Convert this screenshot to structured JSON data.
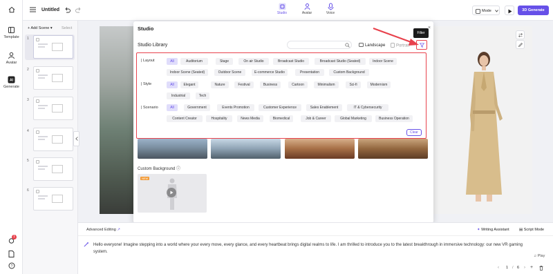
{
  "rail": {
    "items": [
      {
        "label": "Template",
        "icon": "template-icon"
      },
      {
        "label": "Avatar",
        "icon": "avatar-icon"
      },
      {
        "label": "Generate",
        "icon": "ai-generate-icon"
      }
    ],
    "notification_count": "1"
  },
  "topbar": {
    "project_title": "Untitled",
    "tabs": [
      {
        "label": "Studio",
        "icon": "studio-icon"
      },
      {
        "label": "Avatar",
        "icon": "avatar-icon"
      },
      {
        "label": "Voice",
        "icon": "voice-icon"
      }
    ],
    "mode_label": "Mode",
    "generate_label": "3D Generate"
  },
  "scenes": {
    "add_label": "Add Scene",
    "select_label": "Select",
    "items": [
      "1",
      "2",
      "3",
      "4",
      "5",
      "6"
    ]
  },
  "studio": {
    "title": "Studio",
    "library_label": "Studio Library",
    "landscape_label": "Landscape",
    "portrait_label": "Portrait",
    "filter_tooltip": "Filter",
    "custom_background_label": "Custom Background",
    "upload_badge": "NEW"
  },
  "filters": {
    "layout": {
      "label": "Layout",
      "options": [
        "All",
        "Auditorium",
        "Stage",
        "On air Studio",
        "Broadcast Studio",
        "Broadcast Studio (Seated)",
        "Indoor Scene",
        "Indoor Scene (Seated)",
        "Outdoor Scene",
        "E-commerce Studio",
        "Presentation",
        "Custom Background"
      ]
    },
    "style": {
      "label": "Style",
      "options": [
        "All",
        "Elegant",
        "Nature",
        "Festival",
        "Business",
        "Cartoon",
        "Minimalism",
        "Sci-fi",
        "Modernism",
        "Industrial",
        "Tech"
      ]
    },
    "scenario": {
      "label": "Scenario",
      "options": [
        "All",
        "Government",
        "Events Promotion",
        "Customer Experience",
        "Sales Enablement",
        "IT & Cybersecurity",
        "Content Creator",
        "Hospitality",
        "News Media",
        "Biomedical",
        "Job & Career",
        "Global Marketing",
        "Business Operation"
      ]
    },
    "clear_label": "Clear"
  },
  "script": {
    "advanced_label": "Advanced Editing",
    "writing_assistant_label": "Writing Assistant",
    "script_mode_label": "Script Mode",
    "text": "Hello everyone! Imagine stepping into a world where your every move, every glance, and every heartbeat brings digital realms to life. I am thrilled to introduce you to the latest breakthrough in immersive technology: our new VR gaming system.",
    "play_label": "Play",
    "page_current": "1",
    "page_total": "6"
  },
  "colors": {
    "accent": "#6650e8",
    "highlight_red": "#e8414c"
  }
}
